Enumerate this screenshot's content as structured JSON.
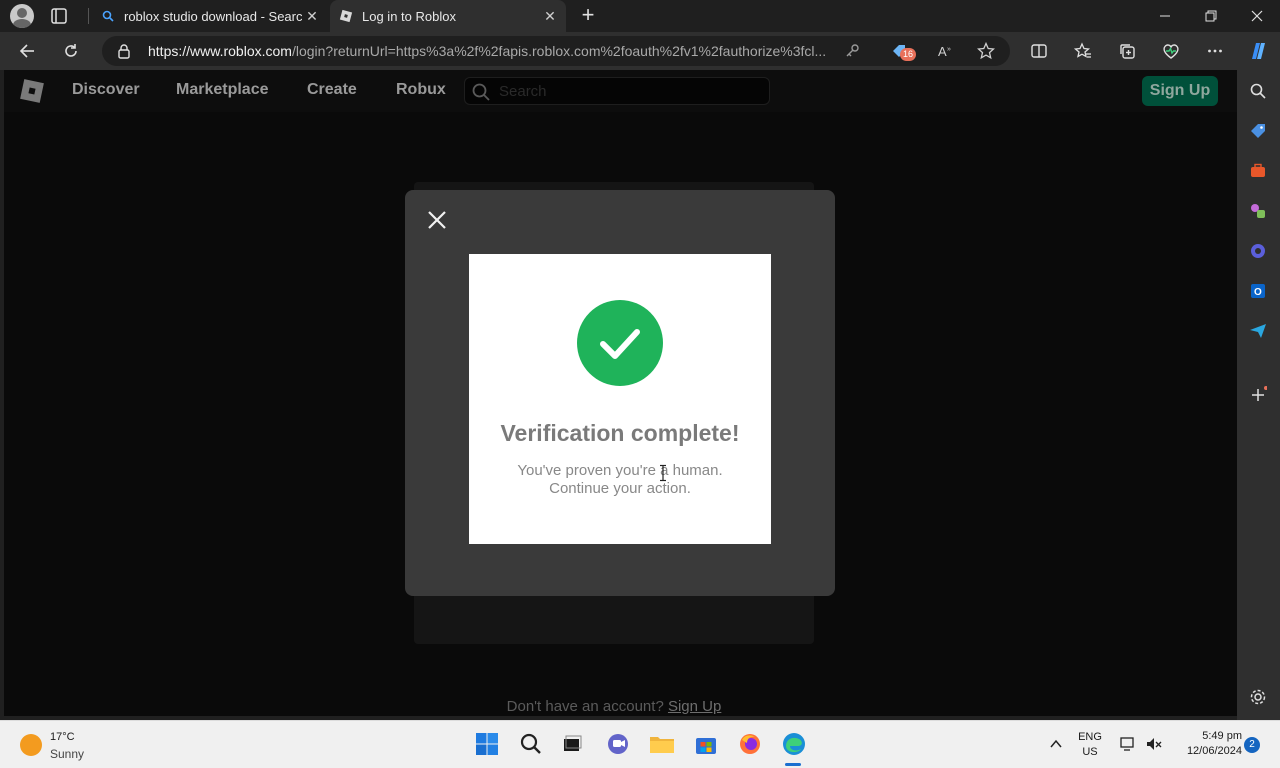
{
  "browser": {
    "tabs": [
      {
        "title": "roblox studio download - Search",
        "active": false
      },
      {
        "title": "Log in to Roblox",
        "active": true
      }
    ],
    "url_host": "https://www.roblox.com",
    "url_rest": "/login?returnUrl=https%3a%2f%2fapis.roblox.com%2foauth%2fv1%2fauthorize%3fcl...",
    "extension_badge": "16"
  },
  "site": {
    "nav": [
      "Discover",
      "Marketplace",
      "Create",
      "Robux"
    ],
    "search_placeholder": "Search",
    "signup_label": "Sign Up",
    "footer_text": "Don't have an account?",
    "footer_link": "Sign Up"
  },
  "dialog": {
    "title": "Verification complete!",
    "message_line1": "You've proven you're a human.",
    "message_line2": "Continue your action."
  },
  "taskbar": {
    "temp": "17°C",
    "condition": "Sunny",
    "lang": "ENG",
    "region": "US",
    "time": "5:49 pm",
    "date": "12/06/2024",
    "notifications": "2"
  },
  "colors": {
    "success": "#1fb35a",
    "signup_bg": "#00503a",
    "page_bg": "#0a0a0a"
  }
}
